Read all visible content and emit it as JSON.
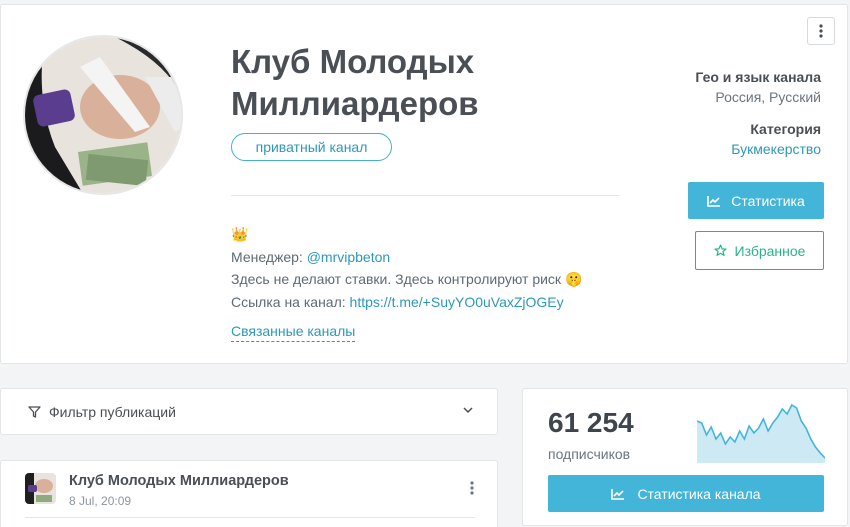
{
  "channel": {
    "title": "Клуб Молодых Миллиардеров",
    "badge": "приватный канал",
    "emoji": "👑",
    "manager_label": "Менеджер: ",
    "manager_handle": "@mrvipbeton",
    "tagline": "Здесь не делают ставки. Здесь контролируют риск 🤫",
    "link_label": "Ссылка на канал: ",
    "link_url": "https://t.me/+SuyYO0uVaxZjOGEy",
    "related_label": "Связанные каналы"
  },
  "info": {
    "geo_heading": "Гео и язык канала",
    "geo_value": "Россия, Русский",
    "category_heading": "Категория",
    "category_value": "Букмекерство"
  },
  "buttons": {
    "stats": "Статистика",
    "favorite": "Избранное",
    "channel_stats": "Статистика канала"
  },
  "filter": {
    "label": "Фильтр публикаций"
  },
  "post": {
    "title": "Клуб Молодых Миллиардеров",
    "date": "8 Jul, 20:09"
  },
  "subscribers": {
    "count": "61 254",
    "label": "подписчиков",
    "trend": [
      40,
      38,
      26,
      34,
      22,
      28,
      17,
      24,
      19,
      30,
      22,
      35,
      28,
      33,
      42,
      30,
      38,
      44,
      52,
      47,
      56,
      53,
      40,
      33,
      22,
      14,
      8,
      3
    ]
  },
  "colors": {
    "accent": "#43b5d9",
    "link": "#2d98b8",
    "favorite": "#2ab38b"
  }
}
